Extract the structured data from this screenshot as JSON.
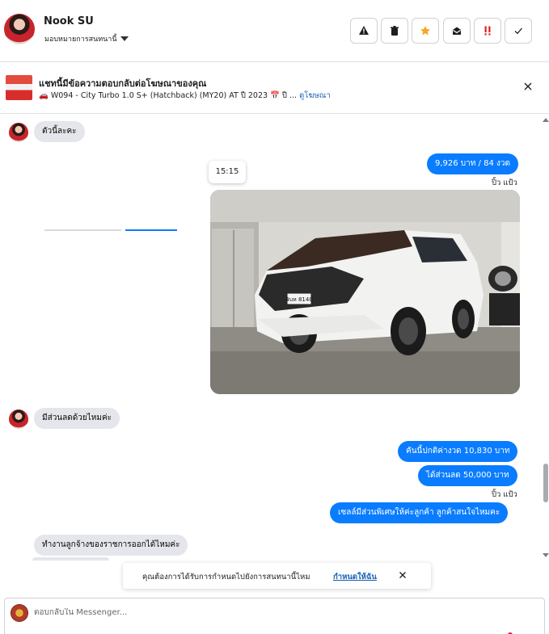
{
  "header": {
    "user_name": "Nook SU",
    "assign_label": "มอบหมายการสนทนานี้"
  },
  "banner": {
    "title": "แชทนี้มีข้อความตอบกลับต่อโฆษณาของคุณ",
    "subtitle": "🚗 W094 - City Turbo 1.0 S+ (Hatchback) (MY20) AT ปี 2023 📅 ปี ...",
    "link": "ดูโฆษณา"
  },
  "messages": {
    "m1": "ตัวนี้ละคะ",
    "m2": "9,926 บาท  / 84 งวด",
    "seen1": "ปิ้ว แป้ว",
    "time": "15:15",
    "m3": "มีส่วนลดด้วยไหมค่ะ",
    "m4": "คันนี้ปกติค่างวด  10,830 บาท",
    "m5": "ได้ส่วนลด 50,000  บาท",
    "seen2": "ปิ้ว แป้ว",
    "m6": "เซลล์มีส่วนพิเศษให้ค่ะลูกค้า  ลูกค้าสนใจไหมคะ",
    "m7": "ทำงานลูกจ้างของราชการออกได้ไหมค่ะ"
  },
  "photo": {
    "plate": "4บห 8140"
  },
  "toast": {
    "text": "คุณต้องการได้รับการกำหนดไปยังการสนทนานี้ไหม",
    "link": "กำหนดให้ฉัน"
  },
  "composer": {
    "placeholder": "ตอบกลับใน Messenger..."
  },
  "colors": {
    "accent": "#0a7cff",
    "incoming": "#e4e6eb",
    "star": "#f5a623",
    "urgent": "#e02020"
  },
  "icons": [
    "warning-icon",
    "trash-icon",
    "star-icon",
    "envelope-open-icon",
    "exclamation-icon",
    "check-icon",
    "close-icon"
  ]
}
